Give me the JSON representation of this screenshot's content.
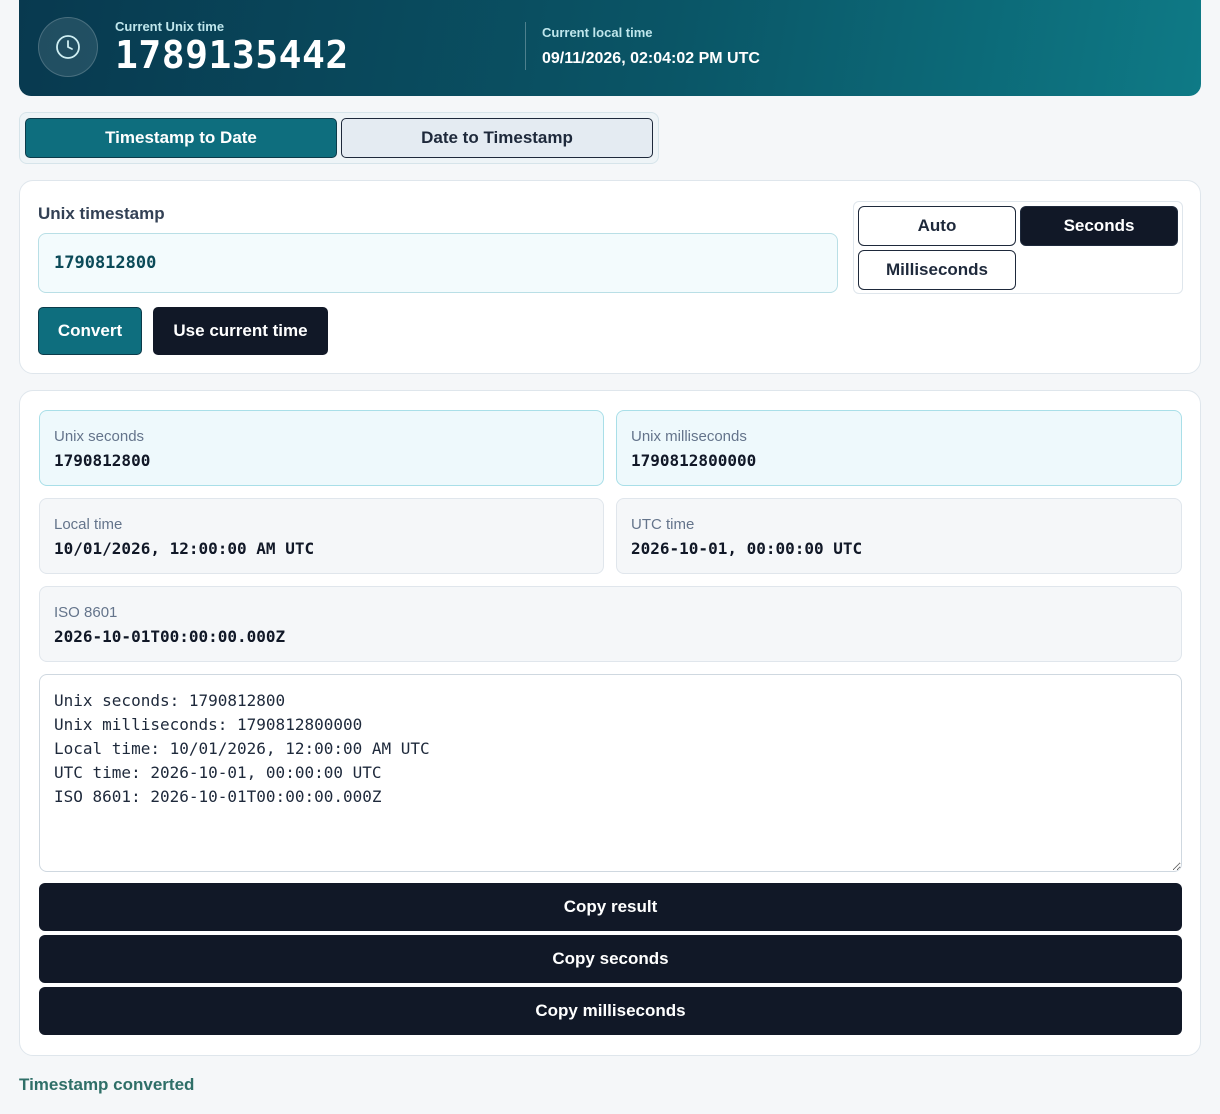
{
  "header": {
    "unix_label": "Current Unix time",
    "unix_value": "1789135442",
    "local_label": "Current local time",
    "local_value": "09/11/2026, 02:04:02 PM UTC",
    "icon": "clock-icon"
  },
  "modes": {
    "timestamp_to_date": "Timestamp to Date",
    "date_to_timestamp": "Date to Timestamp",
    "active": "Timestamp to Date"
  },
  "input": {
    "label": "Unix timestamp",
    "value": "1790812800",
    "units": {
      "auto": "Auto",
      "seconds": "Seconds",
      "milliseconds": "Milliseconds",
      "selected": "Seconds"
    },
    "convert_label": "Convert",
    "use_current_label": "Use current time"
  },
  "results": {
    "unix_seconds": {
      "label": "Unix seconds",
      "value": "1790812800"
    },
    "unix_milliseconds": {
      "label": "Unix milliseconds",
      "value": "1790812800000"
    },
    "local_time": {
      "label": "Local time",
      "value": "10/01/2026, 12:00:00 AM UTC"
    },
    "utc_time": {
      "label": "UTC time",
      "value": "2026-10-01, 00:00:00 UTC"
    },
    "iso": {
      "label": "ISO 8601",
      "value": "2026-10-01T00:00:00.000Z"
    },
    "output_text": "Unix seconds: 1790812800\nUnix milliseconds: 1790812800000\nLocal time: 10/01/2026, 12:00:00 AM UTC\nUTC time: 2026-10-01, 00:00:00 UTC\nISO 8601: 2026-10-01T00:00:00.000Z"
  },
  "actions": {
    "copy_result": "Copy result",
    "copy_seconds": "Copy seconds",
    "copy_milliseconds": "Copy milliseconds"
  },
  "status": "Timestamp converted",
  "colors": {
    "accent": "#0e6e7e",
    "dark": "#111827",
    "status": "#2f6f68"
  }
}
